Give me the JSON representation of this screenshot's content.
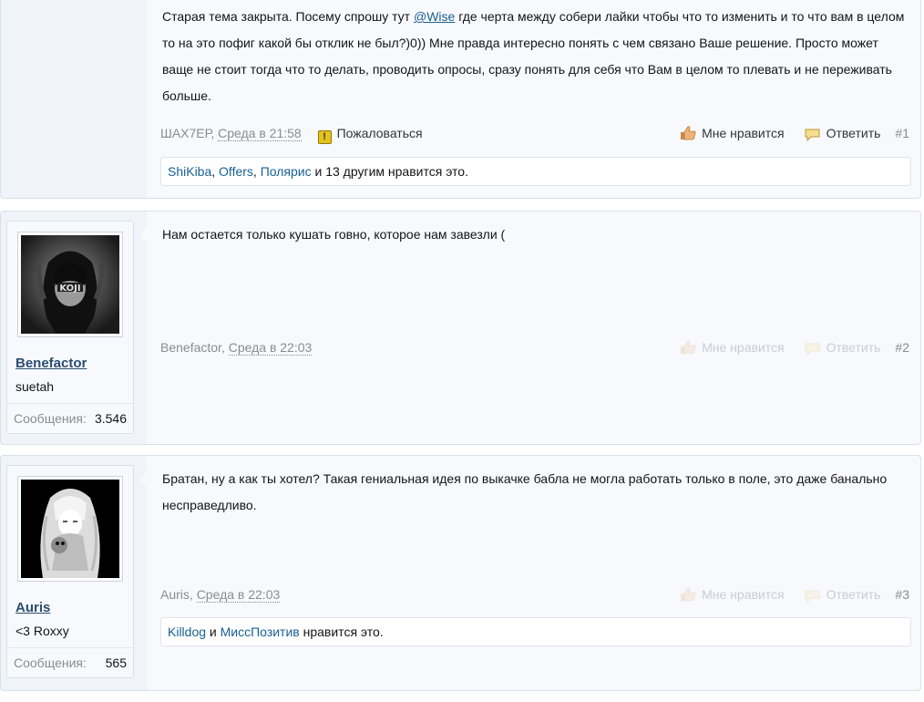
{
  "posts": [
    {
      "text_before": "Старая тема закрыта. Посему спрошу тут ",
      "mention": "@Wise",
      "text_after": " где черта между собери лайки чтобы что то изменить и то что вам в целом то на это пофиг какой бы отклик не был?)0)) Мне правда интересно понять с чем связано Ваше решение. Просто может ваще не стоит тогда что то делать, проводить опросы, сразу понять для себя что Вам в целом то плевать и не переживать больше.",
      "author": "ШАХ7ЕР",
      "time": "Среда в 21:58",
      "report_label": "Пожаловаться",
      "like_label": "Мне нравится",
      "reply_label": "Ответить",
      "number": "#1",
      "likes": {
        "users": [
          "ShiKiba",
          "Offers",
          "Полярис"
        ],
        "sep1": ", ",
        "sep2": ", ",
        "tail": " и 13 другим нравится это."
      }
    },
    {
      "text": "Нам остается только кушать говно, которое нам завезли (",
      "author": "Benefactor",
      "time": "Среда в 22:03",
      "like_label": "Мне нравится",
      "reply_label": "Ответить",
      "number": "#2",
      "user": {
        "name": "Benefactor",
        "title": "suetah",
        "stat_label": "Сообщения:",
        "stat_value": "3.546",
        "avatar_text": "KOJI"
      }
    },
    {
      "text": "Братан, ну а как ты хотел? Такая гениальная идея по выкачке бабла не могла работать только в поле, это даже банально несправедливо.",
      "author": "Auris",
      "time": "Среда в 22:03",
      "like_label": "Мне нравится",
      "reply_label": "Ответить",
      "number": "#3",
      "likes": {
        "users": [
          "Killdog",
          "МиссПозитив"
        ],
        "sep1": " и ",
        "tail": " нравится это."
      },
      "user": {
        "name": "Auris",
        "title": "<3 Roxxy",
        "stat_label": "Сообщения:",
        "stat_value": "565"
      }
    }
  ],
  "colors": {
    "link": "#176093",
    "username": "#2b4d70",
    "muted": "#8c8c8c",
    "post_bg": "#f0f4f8",
    "message_bg": "#f8f9fc"
  },
  "icons": {
    "report": "warning-icon",
    "like": "thumbs-up-icon",
    "reply": "reply-bubble-icon"
  }
}
